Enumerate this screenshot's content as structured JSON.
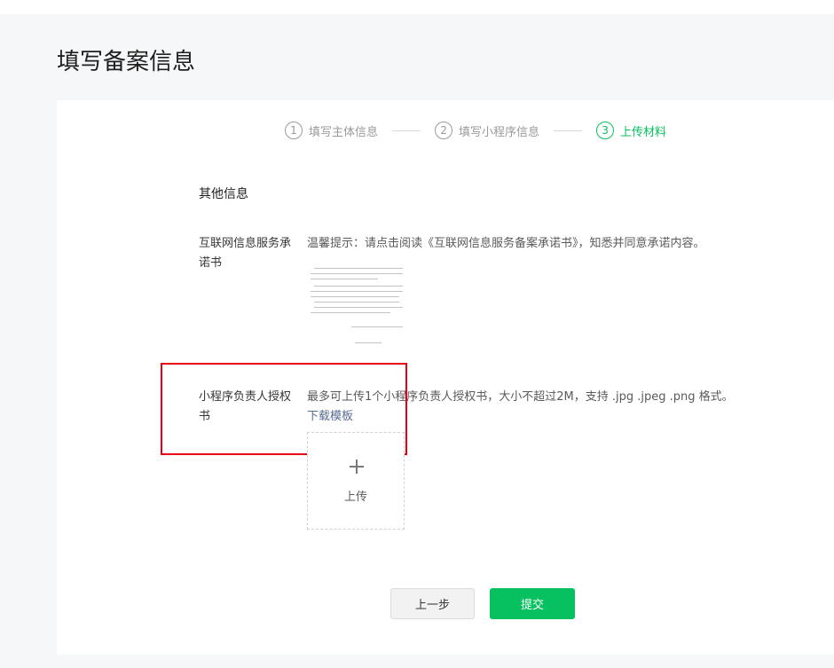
{
  "page": {
    "title": "填写备案信息"
  },
  "steps": [
    {
      "num": "1",
      "label": "填写主体信息"
    },
    {
      "num": "2",
      "label": "填写小程序信息"
    },
    {
      "num": "3",
      "label": "上传材料"
    }
  ],
  "current_step": 3,
  "section": {
    "title": "其他信息"
  },
  "fields": {
    "commitment": {
      "label": "互联网信息服务承诺书",
      "hint": "温馨提示：请点击阅读《互联网信息服务备案承诺书》，知悉并同意承诺内容。"
    },
    "authorization": {
      "label": "小程序负责人授权书",
      "hint": "最多可上传1个小程序负责人授权书，大小不超过2M，支持 .jpg .jpeg .png 格式。",
      "download_label": "下载模板",
      "upload_label": "上传"
    }
  },
  "buttons": {
    "prev": "上一步",
    "submit": "提交"
  },
  "colors": {
    "accent": "#07c160",
    "link": "#576b95",
    "highlight": "#e60012"
  }
}
